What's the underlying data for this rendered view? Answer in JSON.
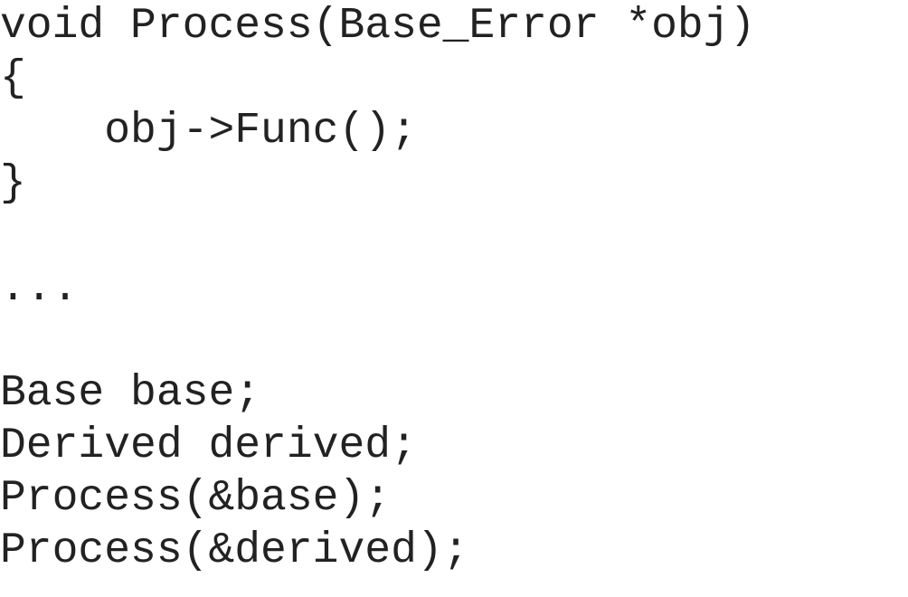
{
  "code": {
    "lines": [
      "void Process(Base_Error *obj)",
      "{",
      "    obj->Func();",
      "}",
      "",
      "...",
      "",
      "Base base;",
      "Derived derived;",
      "Process(&base);",
      "Process(&derived);"
    ]
  }
}
